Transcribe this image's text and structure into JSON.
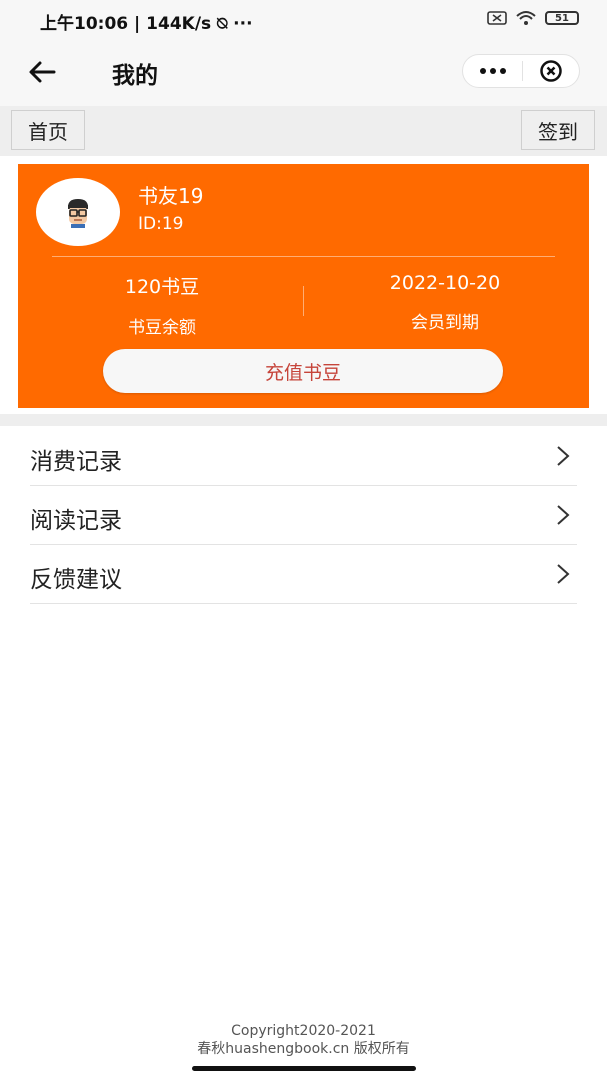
{
  "status_bar": {
    "text": "上午10:06 | 144K/s ⍉ ···",
    "battery": "51"
  },
  "nav": {
    "title": "我的"
  },
  "top_row": {
    "home": "首页",
    "signin": "签到"
  },
  "card": {
    "username": "书友19",
    "user_id": "ID:19",
    "beans_value": "120书豆",
    "beans_label": "书豆余额",
    "expire_value": "2022-10-20",
    "expire_label": "会员到期",
    "recharge": "充值书豆"
  },
  "menu": {
    "items": [
      {
        "label": "消费记录"
      },
      {
        "label": "阅读记录"
      },
      {
        "label": "反馈建议"
      }
    ]
  },
  "footer": {
    "line1": "Copyright2020-2021",
    "line2": "春秋huashengbook.cn 版权所有"
  },
  "colors": {
    "accent": "#ff6a00",
    "recharge_text": "#c6443a"
  }
}
